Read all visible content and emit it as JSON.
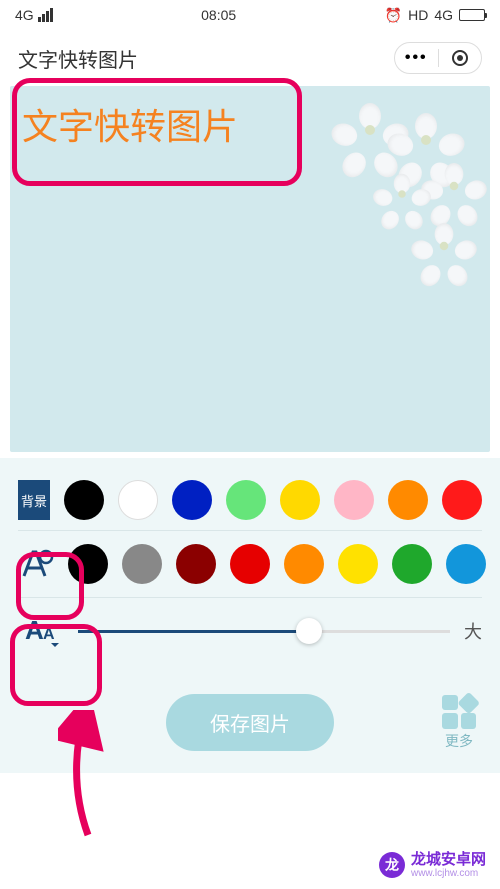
{
  "status": {
    "network": "4G",
    "time": "08:05",
    "hd": "HD",
    "net2": "4G"
  },
  "header": {
    "title": "文字快转图片"
  },
  "canvas": {
    "text": "文字快转图片"
  },
  "bg_row": {
    "label": "背景",
    "colors": [
      "#000000",
      "#ffffff",
      "#0020c2",
      "#66e57a",
      "#ffd900",
      "#ffb6c6",
      "#ff8a00",
      "#ff1a1a"
    ]
  },
  "text_color_row": {
    "colors": [
      "#000000",
      "#888888",
      "#8b0000",
      "#e60000",
      "#ff8a00",
      "#ffe100",
      "#1fa82c",
      "#1296db"
    ]
  },
  "size_row": {
    "end_label": "大"
  },
  "actions": {
    "save": "保存图片",
    "more": "更多"
  },
  "watermark": {
    "main": "龙城安卓网",
    "sub": "www.lcjhw.com"
  }
}
